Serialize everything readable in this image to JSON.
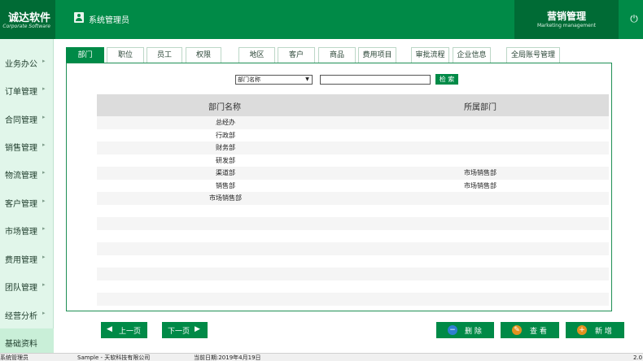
{
  "header": {
    "brand_name": "诚达软件",
    "brand_sub": "Corporate Software",
    "user": "系统管理员",
    "module_title": "营销管理",
    "module_sub": "Marketing management"
  },
  "sidebar": {
    "items": [
      {
        "label": "业务办公"
      },
      {
        "label": "订单管理"
      },
      {
        "label": "合同管理"
      },
      {
        "label": "销售管理"
      },
      {
        "label": "物流管理"
      },
      {
        "label": "客户管理"
      },
      {
        "label": "市场管理"
      },
      {
        "label": "费用管理"
      },
      {
        "label": "团队管理"
      },
      {
        "label": "经营分析"
      },
      {
        "label": "基础资料"
      }
    ]
  },
  "tabs": [
    {
      "label": "部门"
    },
    {
      "label": "职位"
    },
    {
      "label": "员工"
    },
    {
      "label": "权限"
    },
    {
      "label": "地区"
    },
    {
      "label": "客户"
    },
    {
      "label": "商品"
    },
    {
      "label": "费用项目"
    },
    {
      "label": "审批流程"
    },
    {
      "label": "企业信息"
    },
    {
      "label": "全局账号管理"
    }
  ],
  "filter": {
    "select_value": "部门名称",
    "search_value": "",
    "search_button": "检 索"
  },
  "table": {
    "columns": [
      "部门名称",
      "所属部门"
    ],
    "rows": [
      [
        "总经办",
        ""
      ],
      [
        "行政部",
        ""
      ],
      [
        "财务部",
        ""
      ],
      [
        "研发部",
        ""
      ],
      [
        "渠道部",
        "市场销售部"
      ],
      [
        "销售部",
        "市场销售部"
      ],
      [
        "市场销售部",
        ""
      ],
      [
        "",
        ""
      ],
      [
        "",
        ""
      ],
      [
        "",
        ""
      ],
      [
        "",
        ""
      ],
      [
        "",
        ""
      ],
      [
        "",
        ""
      ],
      [
        "",
        ""
      ],
      [
        "",
        ""
      ]
    ]
  },
  "buttons": {
    "prev": "上一页",
    "next": "下一页",
    "delete": "删 除",
    "view": "查 看",
    "add": "新 增"
  },
  "statusbar": {
    "user": "系统管理员",
    "company": "Sample - 天软科技有限公司",
    "date": "当前日期:2019年4月19日",
    "version": "2.0"
  },
  "colors": {
    "brand_green": "#008a47",
    "dark_green": "#006b35",
    "sidebar_bg": "#e1f6ea",
    "header_gray": "#dcdcdc"
  }
}
